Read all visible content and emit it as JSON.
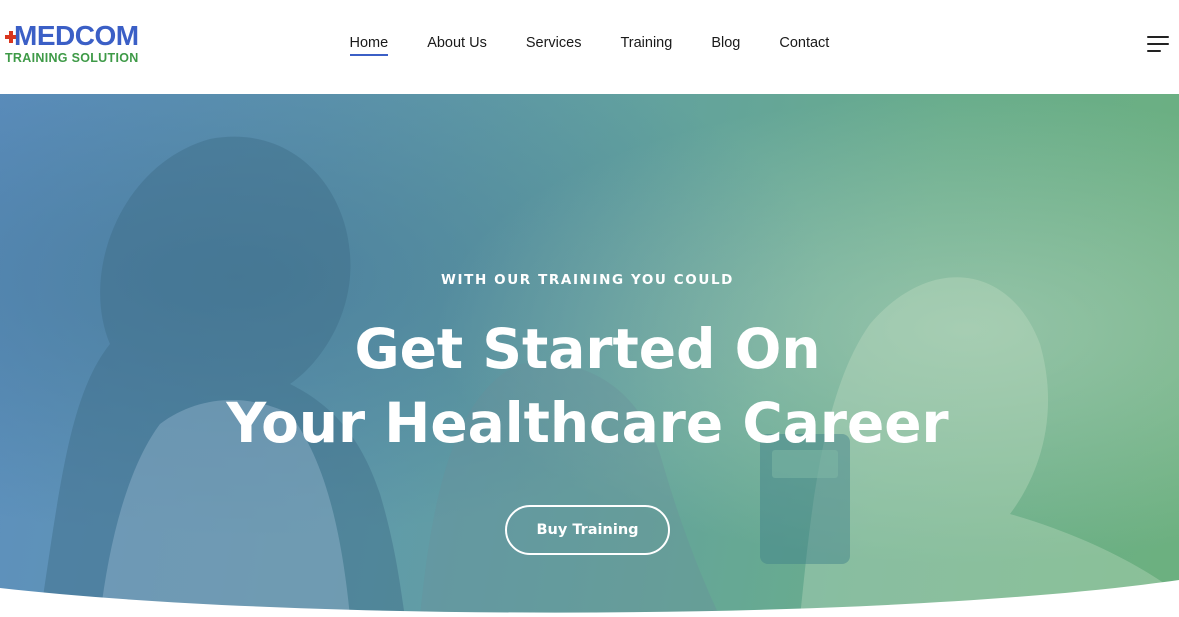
{
  "logo": {
    "top_text": "MEDCOM",
    "bottom_text": "TRAINING SOLUTION",
    "colors": {
      "top": "#3b5fc6",
      "bottom": "#3e9a47",
      "plus": "#d9361e",
      "ring": "#e8782b"
    }
  },
  "nav": {
    "items": [
      {
        "label": "Home",
        "active": true
      },
      {
        "label": "About Us",
        "active": false
      },
      {
        "label": "Services",
        "active": false
      },
      {
        "label": "Training",
        "active": false
      },
      {
        "label": "Blog",
        "active": false
      },
      {
        "label": "Contact",
        "active": false
      }
    ],
    "menu_icon": "hamburger-menu-icon"
  },
  "hero": {
    "eyebrow": "WITH OUR TRAINING YOU COULD",
    "headline_line1": "Get Started On",
    "headline_line2": "Your Healthcare Career",
    "cta_label": "Buy Training",
    "colors": {
      "overlay_left": "#5d8fbf",
      "overlay_right": "#6cb07f",
      "text": "#ffffff"
    }
  }
}
